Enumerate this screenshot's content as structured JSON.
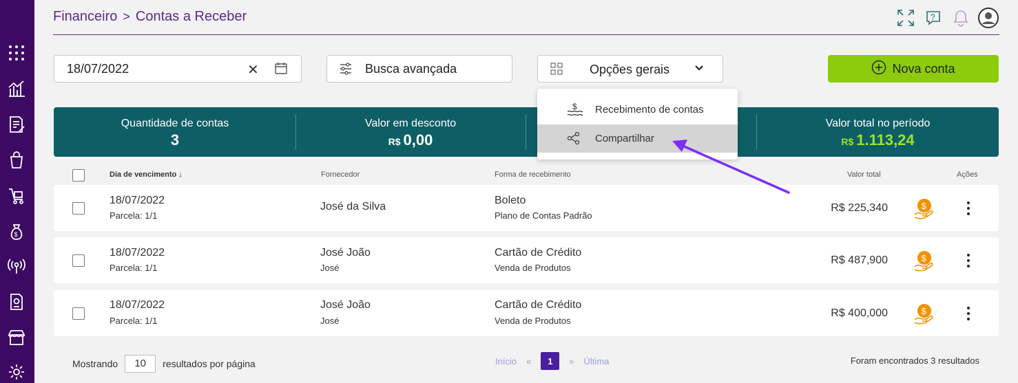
{
  "breadcrumb": {
    "section": "Financeiro",
    "separator": ">",
    "page": "Contas a Receber"
  },
  "header_icons": [
    "expand-icon",
    "help-icon",
    "bell-icon",
    "user-avatar-icon"
  ],
  "sidebar": {
    "items": [
      "apps-grid-icon",
      "chart-icon",
      "invoice-icon",
      "bag-icon",
      "cart-icon",
      "money-bag-icon",
      "broadcast-icon",
      "document-icon",
      "store-icon",
      "gear-icon"
    ]
  },
  "toolbar": {
    "date_value": "18/07/2022",
    "clear": "✕",
    "busca_label": "Busca avançada",
    "opcoes_label": "Opções gerais",
    "nova_label": "Nova conta"
  },
  "dropdown": {
    "items": [
      {
        "label": "Recebimento de contas",
        "icon": "receive-icon"
      },
      {
        "label": "Compartilhar",
        "icon": "share-icon"
      }
    ]
  },
  "summary": {
    "quantidade_label": "Quantidade de contas",
    "quantidade_value": "3",
    "desconto_label": "Valor em desconto",
    "desconto_currency": "R$",
    "desconto_value": "0,00",
    "total_label": "Valor total no período",
    "total_currency": "R$",
    "total_value": "1.113,24"
  },
  "table": {
    "headers": {
      "vencimento": "Dia de vencimento ↓",
      "fornecedor": "Fornecedor",
      "forma": "Forma de recebimento",
      "valor": "Valor total",
      "acoes": "Ações"
    },
    "rows": [
      {
        "date": "18/07/2022",
        "parcela": "Parcela: 1/1",
        "fornecedor": "José da Silva",
        "fornecedor_sub": "",
        "forma": "Boleto",
        "forma_sub": "Plano de Contas Padrão",
        "valor": "R$ 225,340"
      },
      {
        "date": "18/07/2022",
        "parcela": "Parcela: 1/1",
        "fornecedor": "José João",
        "fornecedor_sub": "José",
        "forma": "Cartão de Crédito",
        "forma_sub": "Venda de Produtos",
        "valor": "R$ 487,900"
      },
      {
        "date": "18/07/2022",
        "parcela": "Parcela: 1/1",
        "fornecedor": "José João",
        "fornecedor_sub": "José",
        "forma": "Cartão de Crédito",
        "forma_sub": "Venda de Produtos",
        "valor": "R$ 400,000"
      }
    ]
  },
  "footer": {
    "mostrando": "Mostrando",
    "per_page": "10",
    "resultados": "resultados por página",
    "inicio": "Início",
    "prev": "«",
    "page": "1",
    "next": "»",
    "ultima": "Última",
    "found": "Foram encontrados 3 resultados"
  },
  "colors": {
    "sidebar": "#3d0a63",
    "accent": "#5a2a8c",
    "summary": "#0e5e66",
    "primary_button": "#8ccc0c",
    "highlight_value": "#9ee22a",
    "coin": "#f39200",
    "annotation_arrow": "#7b2ff7"
  }
}
